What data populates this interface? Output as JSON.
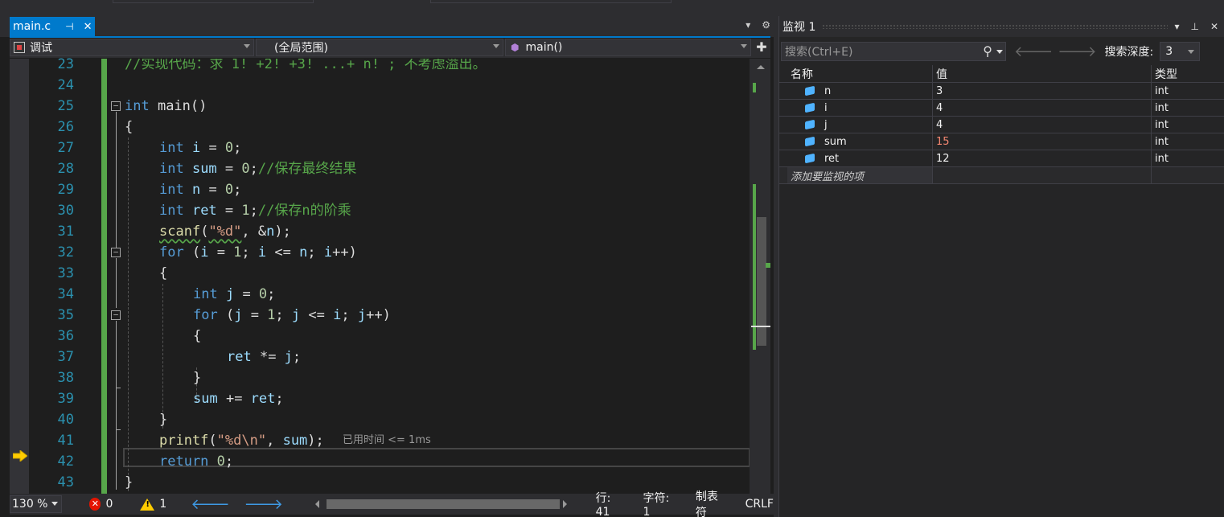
{
  "tab": {
    "filename": "main.c",
    "pin": "⊣",
    "close": "✕"
  },
  "tabbar_controls": {
    "dropdown": "▾",
    "settings": "⚙"
  },
  "navbar": {
    "project": "调试",
    "scope": "(全局范围)",
    "function": "main()",
    "split": "✚"
  },
  "line_numbers": [
    "23",
    "24",
    "25",
    "26",
    "27",
    "28",
    "29",
    "30",
    "31",
    "32",
    "33",
    "34",
    "35",
    "36",
    "37",
    "38",
    "39",
    "40",
    "41",
    "42",
    "43"
  ],
  "code": {
    "l23": "//实现代码：求 1! +2! +3! ...+ n! ; 不考虑溢出。",
    "l25_kw": "int",
    "l25_rest": " main()",
    "l26": "{",
    "l27_kw": "int",
    "l27_var": " i",
    "l27_op": " = ",
    "l27_num": "0",
    "l27_end": ";",
    "l28_kw": "int",
    "l28_var": " sum",
    "l28_op": " = ",
    "l28_num": "0",
    "l28_end": ";",
    "l28_cm": "//保存最终结果",
    "l29_kw": "int",
    "l29_var": " n",
    "l29_op": " = ",
    "l29_num": "0",
    "l29_end": ";",
    "l30_kw": "int",
    "l30_var": " ret",
    "l30_op": " = ",
    "l30_num": "1",
    "l30_end": ";",
    "l30_cm": "//保存n的阶乘",
    "l31_fn": "scanf",
    "l31_a": "(",
    "l31_str": "\"%d\"",
    "l31_b": ", &",
    "l31_var": "n",
    "l31_c": ");",
    "l32_kw": "for",
    "l32_a": " (",
    "l32_v1": "i",
    "l32_b": " = ",
    "l32_n1": "1",
    "l32_c": "; ",
    "l32_v2": "i",
    "l32_d": " <= ",
    "l32_v3": "n",
    "l32_e": "; ",
    "l32_v4": "i",
    "l32_f": "++)",
    "l33": "{",
    "l34_kw": "int",
    "l34_var": " j",
    "l34_op": " = ",
    "l34_num": "0",
    "l34_end": ";",
    "l35_kw": "for",
    "l35_a": " (",
    "l35_v1": "j",
    "l35_b": " = ",
    "l35_n1": "1",
    "l35_c": "; ",
    "l35_v2": "j",
    "l35_d": " <= ",
    "l35_v3": "i",
    "l35_e": "; ",
    "l35_v4": "j",
    "l35_f": "++)",
    "l36": "{",
    "l37_v1": "ret",
    "l37_op": " *= ",
    "l37_v2": "j",
    "l37_end": ";",
    "l38": "}",
    "l39_v1": "sum",
    "l39_op": " += ",
    "l39_v2": "ret",
    "l39_end": ";",
    "l40": "}",
    "l41_fn": "printf",
    "l41_a": "(",
    "l41_str": "\"%d\\n\"",
    "l41_b": ", ",
    "l41_var": "sum",
    "l41_c": ");",
    "l41_elapsed": "已用时间 <= 1ms",
    "l42_kw": "return",
    "l42_sp": " ",
    "l42_num": "0",
    "l42_end": ";",
    "l43": "}"
  },
  "statusbar": {
    "zoom": "130 %",
    "errors": "0",
    "warnings": "1",
    "line": "行: 41",
    "char": "字符: 1",
    "tabs": "制表符",
    "eol": "CRLF"
  },
  "watch": {
    "title": "监视 1",
    "search_placeholder": "搜索(Ctrl+E)",
    "depth_label": "搜索深度:",
    "depth_value": "3",
    "columns": [
      "名称",
      "值",
      "类型"
    ],
    "rows": [
      {
        "name": "n",
        "value": "3",
        "type": "int"
      },
      {
        "name": "i",
        "value": "4",
        "type": "int"
      },
      {
        "name": "j",
        "value": "4",
        "type": "int"
      },
      {
        "name": "sum",
        "value": "15",
        "type": "int"
      },
      {
        "name": "ret",
        "value": "12",
        "type": "int"
      }
    ],
    "add_item": "添加要监视的项"
  },
  "colors": {
    "accent": "#007acc",
    "keyword": "#569cd6",
    "comment": "#57a64a",
    "string": "#d69d85",
    "changed_value": "#f48771"
  }
}
